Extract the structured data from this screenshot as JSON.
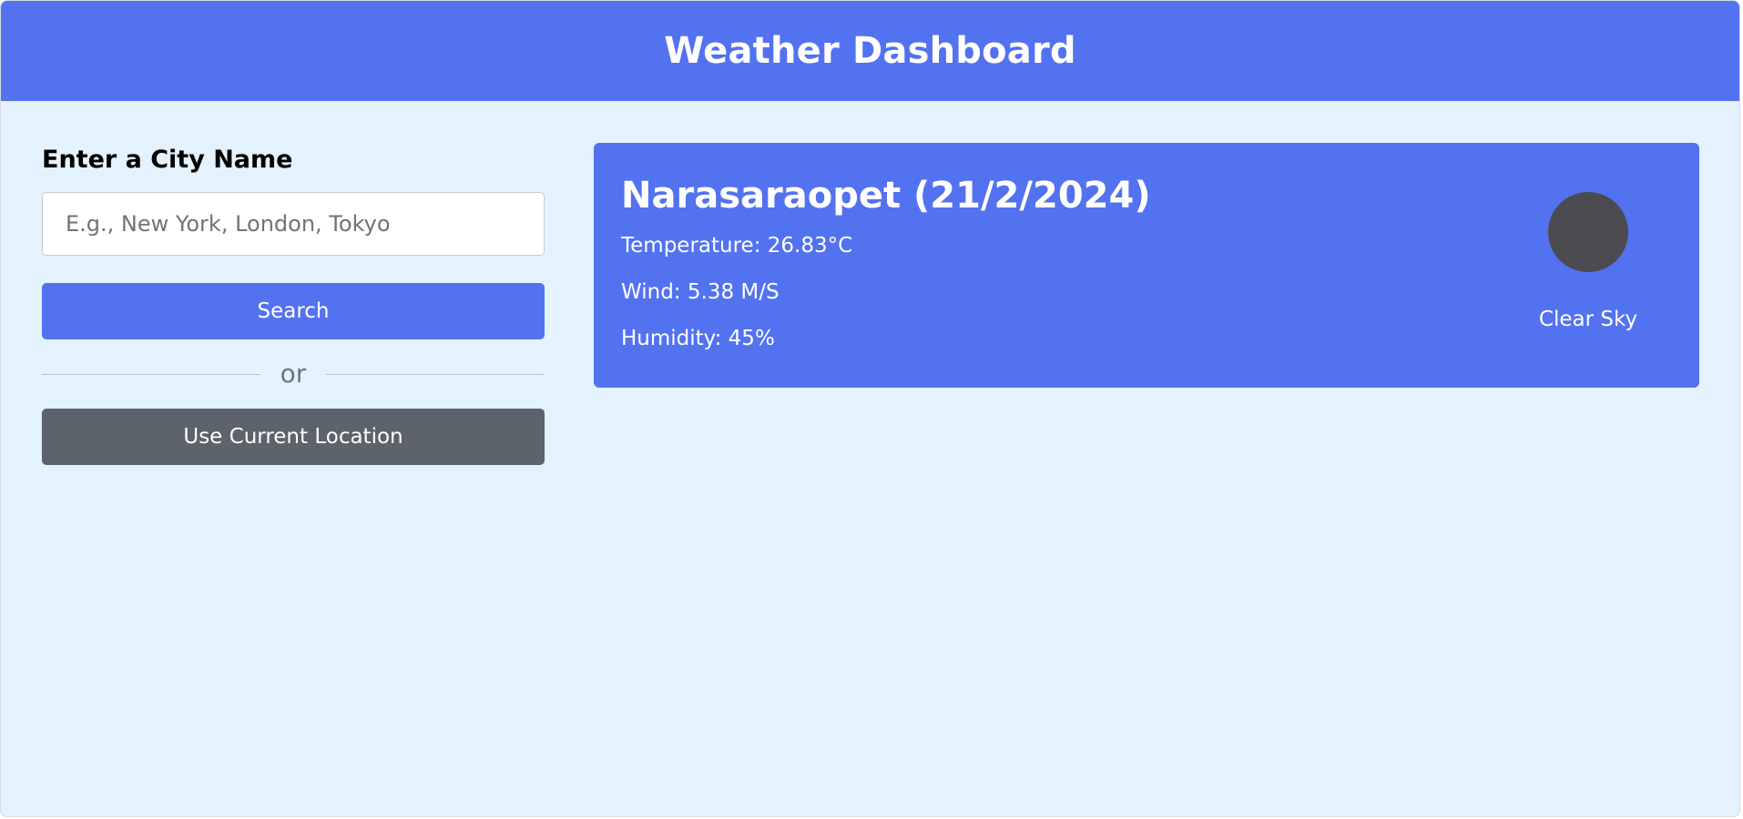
{
  "header": {
    "title": "Weather Dashboard"
  },
  "sidebar": {
    "label": "Enter a City Name",
    "input_placeholder": "E.g., New York, London, Tokyo",
    "input_value": "",
    "search_label": "Search",
    "separator_text": "or",
    "location_label": "Use Current Location"
  },
  "current_weather": {
    "title": "Narasaraopet (21/2/2024)",
    "temperature": "Temperature: 26.83°C",
    "wind": "Wind: 5.38 M/S",
    "humidity": "Humidity: 45%",
    "icon": "weather-icon",
    "condition": "Clear Sky"
  },
  "colors": {
    "accent": "#5372f0",
    "background": "#e3f2fd",
    "secondary_button": "#5c636a"
  }
}
